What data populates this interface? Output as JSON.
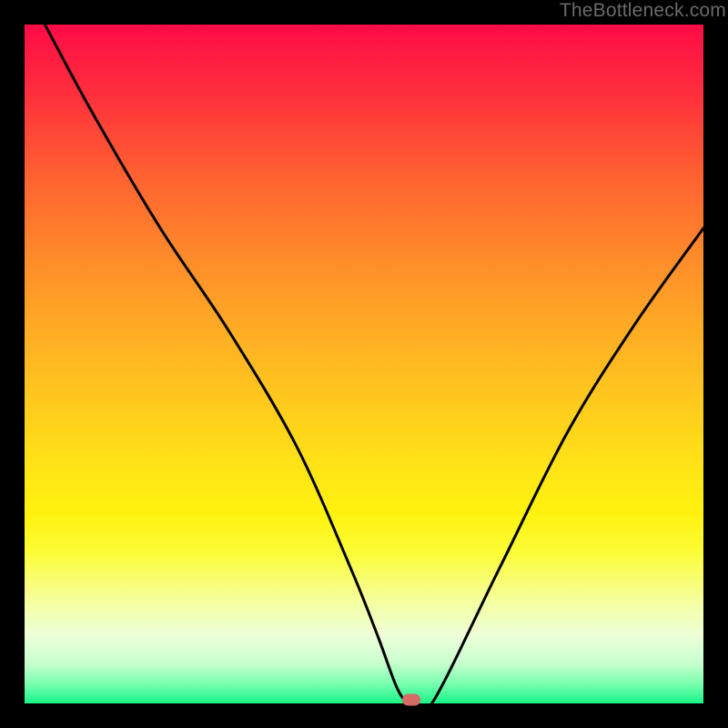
{
  "watermark": "TheBottleneck.com",
  "marker": {
    "x_pct": 57,
    "y_pct": 100
  },
  "chart_data": {
    "type": "line",
    "title": "",
    "xlabel": "",
    "ylabel": "",
    "xlim": [
      0,
      100
    ],
    "ylim": [
      0,
      100
    ],
    "x": [
      3,
      10,
      20,
      30,
      40,
      48,
      52,
      55,
      57,
      60,
      70,
      80,
      90,
      100
    ],
    "values": [
      100,
      87,
      70,
      55,
      38,
      20,
      10,
      2,
      0,
      0,
      20,
      40,
      56,
      70
    ],
    "annotations": [
      {
        "type": "marker",
        "x": 57,
        "y": 0,
        "color": "#d66a64"
      }
    ],
    "background_gradient": [
      "#ff0b46",
      "#ff6031",
      "#ffaf24",
      "#ffe516",
      "#fbfc39",
      "#edffd8",
      "#17f388"
    ]
  }
}
